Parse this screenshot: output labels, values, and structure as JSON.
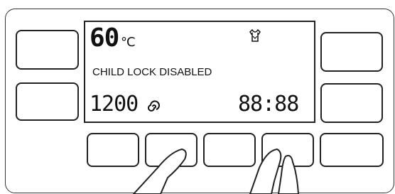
{
  "display": {
    "temperature": "60",
    "temperature_unit": "°C",
    "message": "CHILD LOCK DISABLED",
    "spin_speed": "1200",
    "time": "88:88"
  },
  "icons": {
    "spin": "spin-icon",
    "shirt": "shirt-icon"
  }
}
